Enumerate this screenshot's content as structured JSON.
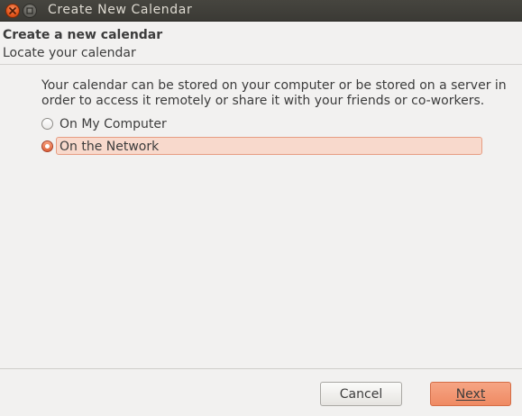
{
  "window": {
    "title": "Create New Calendar",
    "close_icon": "close-icon",
    "minimize_icon": "minimize-icon"
  },
  "header": {
    "title": "Create a new calendar",
    "subtitle": "Locate your calendar"
  },
  "content": {
    "description": "Your calendar can be stored on your computer or be stored on a server in order to access it remotely or share it with your friends or co-workers.",
    "options": [
      {
        "label": "On My Computer",
        "selected": false
      },
      {
        "label": "On the Network",
        "selected": true
      }
    ]
  },
  "buttons": {
    "cancel": "Cancel",
    "next": "Next"
  },
  "colors": {
    "accent": "#e5561c",
    "selection_bg": "#f8d9cc",
    "titlebar": "#3b3a35"
  }
}
